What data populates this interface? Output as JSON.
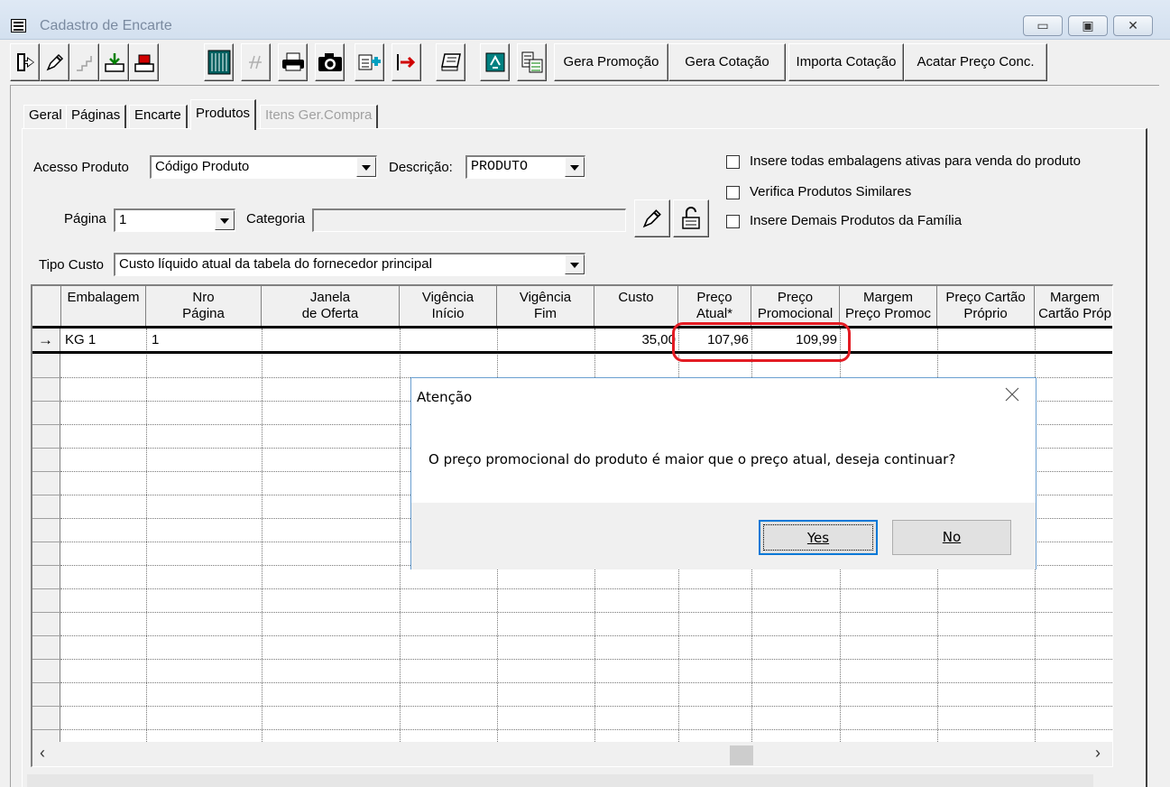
{
  "window": {
    "title": "Cadastro de Encarte",
    "minimize_glyph": "▭",
    "maximize_glyph": "▣",
    "close_glyph": "✕"
  },
  "toolbar": {
    "icons": [
      "exit-door-icon",
      "edit-pencil-icon",
      "disabled-stairs-icon",
      "import-tray-icon",
      "export-tray-icon",
      "columns-grid-icon",
      "disabled-script-icon",
      "print-icon",
      "camera-icon",
      "add-item-icon",
      "transfer-icon",
      "notes-icon",
      "refresh-icon",
      "table-list-icon"
    ],
    "gera_promocao": "Gera Promoção",
    "gera_cotacao": "Gera Cotação",
    "importa_cotacao": "Importa Cotação",
    "acatar_preco": "Acatar Preço Conc."
  },
  "tabs": {
    "geral": "Geral",
    "paginas": "Páginas",
    "encarte": "Encarte",
    "produtos": "Produtos",
    "itens_ger_compra": "Itens Ger.Compra"
  },
  "form": {
    "acesso_produto_label": "Acesso Produto",
    "acesso_produto_value": "Código Produto",
    "descricao_label": "Descrição:",
    "descricao_value": "PRODUTO",
    "pagina_label": "Página",
    "pagina_value": "1",
    "categoria_label": "Categoria",
    "tipo_custo_label": "Tipo Custo",
    "tipo_custo_value": "Custo líquido atual da tabela do fornecedor principal",
    "chk_embalagens": "Insere todas embalagens ativas para venda do produto",
    "chk_similares": "Verifica Produtos Similares",
    "chk_familia": "Insere Demais Produtos da Família"
  },
  "grid": {
    "headers": [
      {
        "l1": "Embalagem",
        "l2": ""
      },
      {
        "l1": "Nro",
        "l2": "Página"
      },
      {
        "l1": "Janela",
        "l2": "de Oferta"
      },
      {
        "l1": "Vigência",
        "l2": "Início"
      },
      {
        "l1": "Vigência",
        "l2": "Fim"
      },
      {
        "l1": "Custo",
        "l2": ""
      },
      {
        "l1": "Preço",
        "l2": "Atual*"
      },
      {
        "l1": "Preço",
        "l2": "Promocional"
      },
      {
        "l1": "Margem",
        "l2": "Preço Promoc"
      },
      {
        "l1": "Preço Cartão",
        "l2": "Próprio"
      },
      {
        "l1": "Margem",
        "l2": "Cartão Próp"
      }
    ],
    "row": {
      "indicator": "→",
      "embalagem": "KG  1",
      "nro_pagina": "1",
      "custo": "35,00",
      "preco_atual": "107,96",
      "preco_promocional": "109,99"
    },
    "scroll_left": "‹",
    "scroll_right": "›"
  },
  "dialog": {
    "title": "Atenção",
    "message": "O preço promocional do produto é maior que o preço atual, deseja continuar?",
    "yes": "Yes",
    "no": "No"
  }
}
